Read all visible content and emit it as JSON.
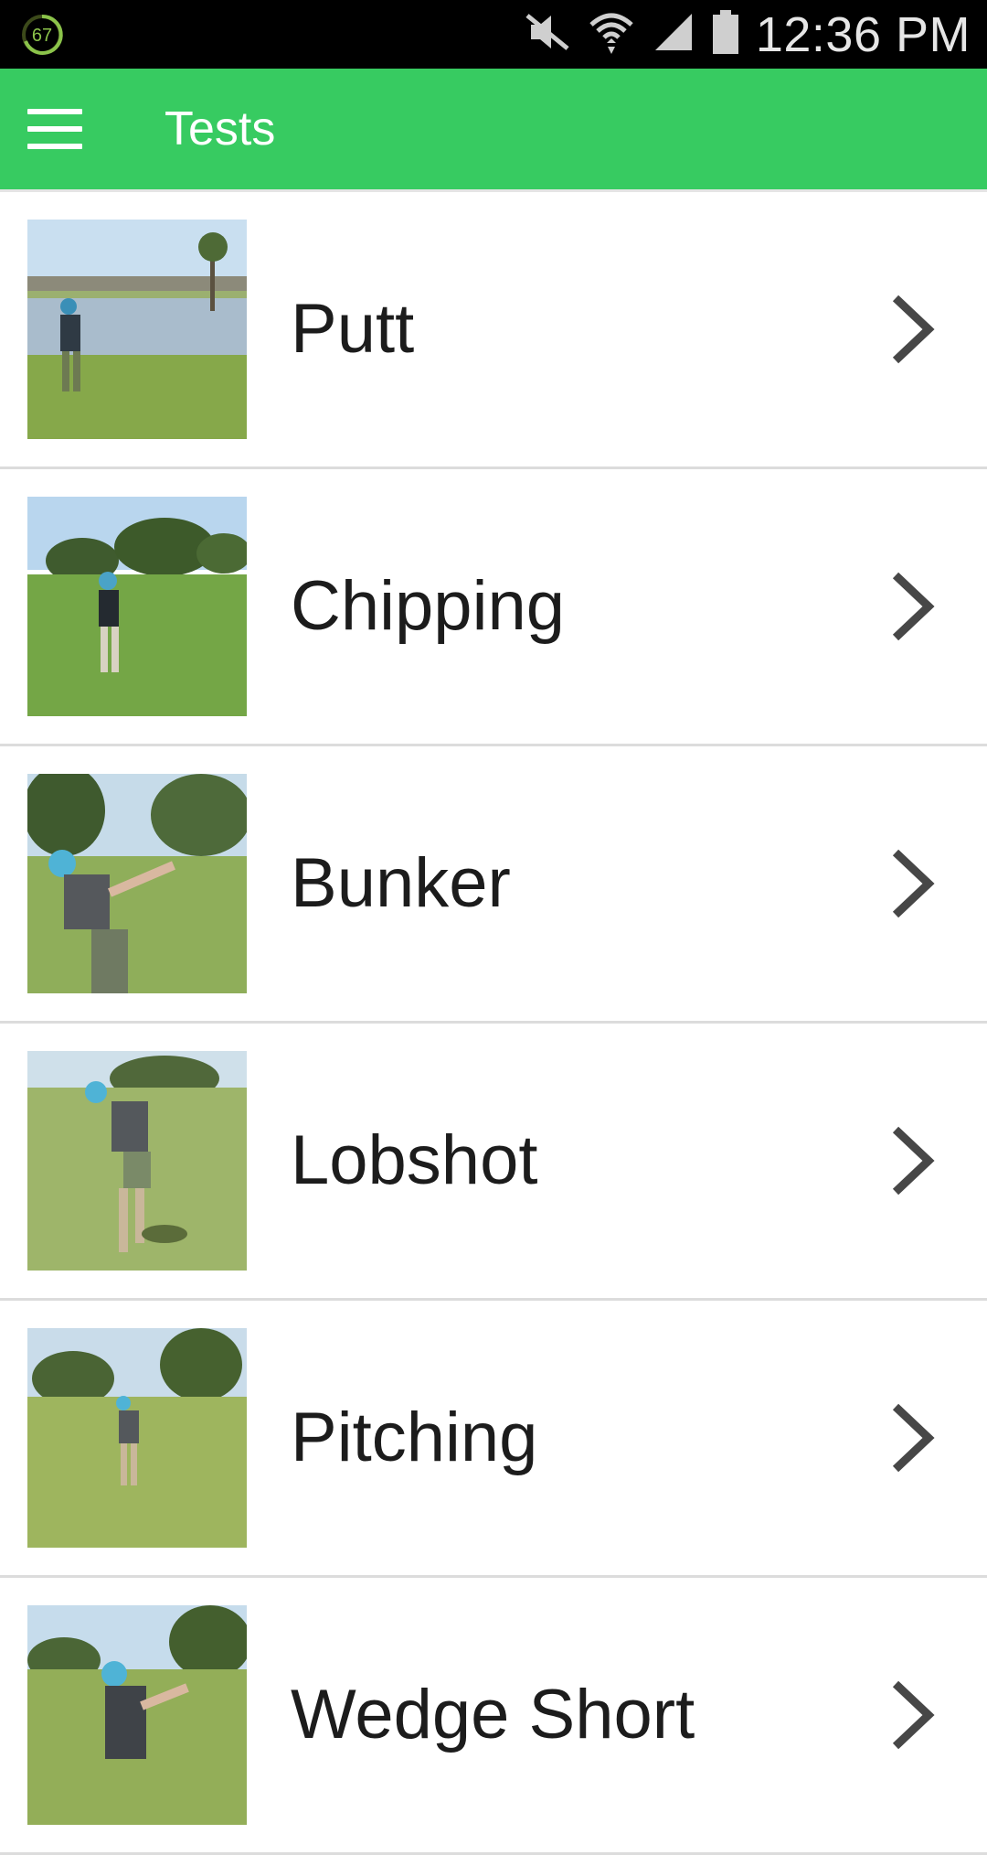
{
  "status_bar": {
    "battery_badge": "67",
    "time": "12:36 PM",
    "icons": [
      "circular-battery-badge-icon",
      "mute-icon",
      "wifi-icon",
      "signal-icon",
      "battery-icon"
    ]
  },
  "app_bar": {
    "title": "Tests",
    "menu_icon": "hamburger-menu-icon",
    "background_color": "#37cb61"
  },
  "list": {
    "items": [
      {
        "label": "Putt",
        "thumbnail": "golfer-putting-by-pond"
      },
      {
        "label": "Chipping",
        "thumbnail": "golfer-chipping-on-green"
      },
      {
        "label": "Bunker",
        "thumbnail": "golfer-bunker-swing"
      },
      {
        "label": "Lobshot",
        "thumbnail": "golfer-lobshot-swing"
      },
      {
        "label": "Pitching",
        "thumbnail": "golfer-pitching-fairway"
      },
      {
        "label": "Wedge Short",
        "thumbnail": "golfer-wedge-short-swing"
      }
    ],
    "chevron_icon": "chevron-right-icon"
  }
}
